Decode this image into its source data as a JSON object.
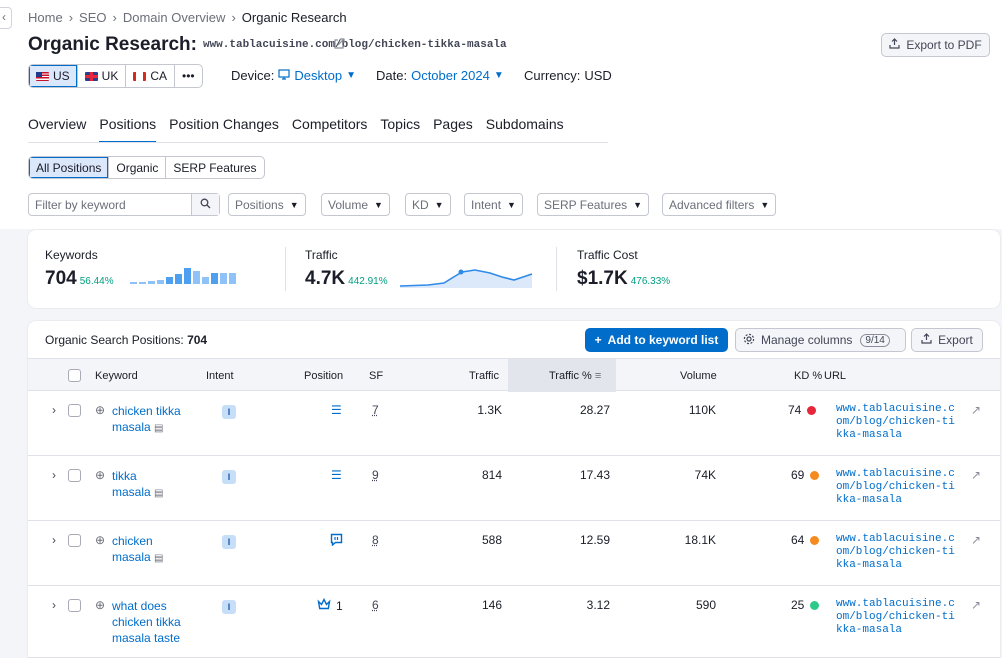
{
  "breadcrumb": [
    "Home",
    "SEO",
    "Domain Overview",
    "Organic Research"
  ],
  "header": {
    "title_prefix": "Organic Research:",
    "title_url": "www.tablacuisine.com/blog/chicken-tikka-masala",
    "export_pdf": "Export to PDF"
  },
  "databases": [
    {
      "code": "US",
      "flag": "us",
      "active": true
    },
    {
      "code": "UK",
      "flag": "uk",
      "active": false
    },
    {
      "code": "CA",
      "flag": "ca",
      "active": false
    }
  ],
  "more_label": "•••",
  "options": {
    "device_label": "Device:",
    "device_value": "Desktop",
    "date_label": "Date:",
    "date_value": "October 2024",
    "currency_label": "Currency:",
    "currency_value": "USD"
  },
  "tabs": [
    "Overview",
    "Positions",
    "Position Changes",
    "Competitors",
    "Topics",
    "Pages",
    "Subdomains"
  ],
  "active_tab": "Positions",
  "position_types": [
    "All Positions",
    "Organic",
    "SERP Features"
  ],
  "search": {
    "placeholder": "Filter by keyword"
  },
  "filters": [
    "Positions",
    "Volume",
    "KD",
    "Intent",
    "SERP Features",
    "Advanced filters"
  ],
  "summary": {
    "keywords": {
      "label": "Keywords",
      "value": "704",
      "change": "56.44%"
    },
    "traffic": {
      "label": "Traffic",
      "value": "4.7K",
      "change": "442.91%"
    },
    "traffic_cost": {
      "label": "Traffic Cost",
      "value": "$1.7K",
      "change": "476.33%"
    }
  },
  "table": {
    "title": "Organic Search Positions:",
    "count": "704",
    "add_button": "Add to keyword list",
    "manage_columns": "Manage columns",
    "columns_count": "9/14",
    "export": "Export",
    "headers": {
      "keyword": "Keyword",
      "intent": "Intent",
      "position": "Position",
      "sf": "SF",
      "traffic": "Traffic",
      "traffic_pct": "Traffic %",
      "volume": "Volume",
      "kd": "KD %",
      "url": "URL"
    },
    "rows": [
      {
        "keyword_l1": "chicken tikka",
        "keyword_l2": "masala",
        "intent": "I",
        "position": "",
        "position_icon": "list-icon",
        "sf": "7",
        "traffic": "1.3K",
        "traffic_pct": "28.27",
        "volume": "110K",
        "kd": "74",
        "kd_color": "#e5263b",
        "url": "www.tablacuisine.com/blog/chicken-tikka-masala"
      },
      {
        "keyword_l1": "tikka",
        "keyword_l2": "masala",
        "intent": "I",
        "position": "",
        "position_icon": "list-icon",
        "sf": "9",
        "traffic": "814",
        "traffic_pct": "17.43",
        "volume": "74K",
        "kd": "69",
        "kd_color": "#f58a1f",
        "url": "www.tablacuisine.com/blog/chicken-tikka-masala"
      },
      {
        "keyword_l1": "chicken",
        "keyword_l2": "masala",
        "intent": "I",
        "position": "",
        "position_icon": "featured-snippet-icon",
        "sf": "8",
        "traffic": "588",
        "traffic_pct": "12.59",
        "volume": "18.1K",
        "kd": "64",
        "kd_color": "#f58a1f",
        "url": "www.tablacuisine.com/blog/chicken-tikka-masala"
      },
      {
        "keyword_l1": "what does",
        "keyword_l2": "chicken tikka",
        "keyword_l3": "masala taste",
        "intent": "I",
        "position": "1",
        "position_icon": "crown-icon",
        "sf": "6",
        "traffic": "146",
        "traffic_pct": "3.12",
        "volume": "590",
        "kd": "25",
        "kd_color": "#2fc98a",
        "url": "www.tablacuisine.com/blog/chicken-tikka-masala"
      }
    ]
  },
  "colors": {
    "accent": "#006dca",
    "positive": "#009f81"
  }
}
